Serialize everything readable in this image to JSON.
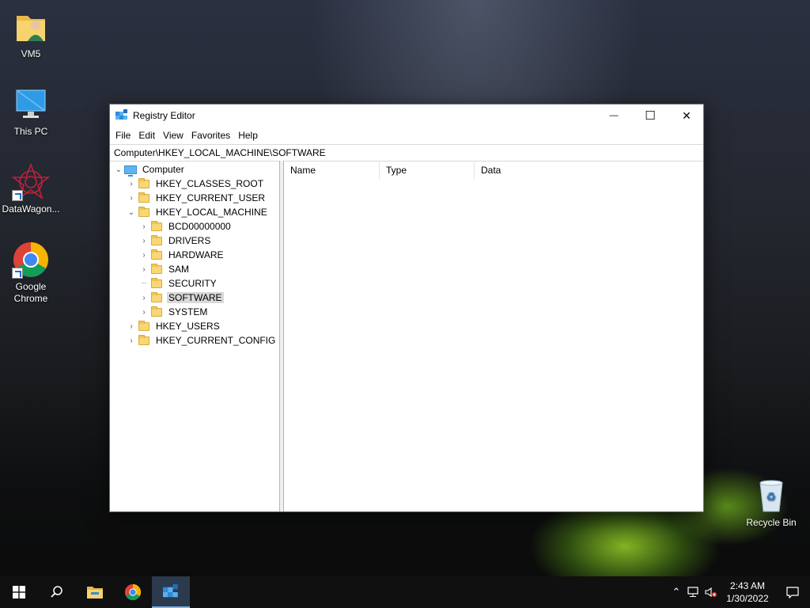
{
  "desktop": {
    "icons": [
      {
        "label": "VM5"
      },
      {
        "label": "This PC"
      },
      {
        "label": "DataWagon..."
      },
      {
        "label": "Google Chrome"
      },
      {
        "label": "Recycle Bin"
      }
    ]
  },
  "window": {
    "title": "Registry Editor",
    "controls": {
      "minimize": "—",
      "maximize": "☐",
      "close": "✕"
    },
    "menu": [
      "File",
      "Edit",
      "View",
      "Favorites",
      "Help"
    ],
    "address": "Computer\\HKEY_LOCAL_MACHINE\\SOFTWARE",
    "tree": {
      "root": "Computer",
      "hives": [
        "HKEY_CLASSES_ROOT",
        "HKEY_CURRENT_USER",
        "HKEY_LOCAL_MACHINE",
        "HKEY_USERS",
        "HKEY_CURRENT_CONFIG"
      ],
      "hklm_children": [
        "BCD00000000",
        "DRIVERS",
        "HARDWARE",
        "SAM",
        "SECURITY",
        "SOFTWARE",
        "SYSTEM"
      ],
      "selected": "SOFTWARE"
    },
    "columns": [
      "Name",
      "Type",
      "Data"
    ]
  },
  "taskbar": {
    "time": "2:43 AM",
    "date": "1/30/2022"
  },
  "colors": {
    "accent": "#0078d7",
    "selection": "#d9d9d9",
    "folder": "#f8d775"
  }
}
